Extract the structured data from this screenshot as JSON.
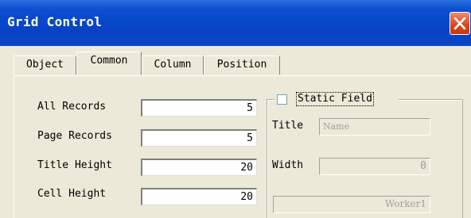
{
  "window": {
    "title": "Grid Control",
    "close_icon": "close-icon"
  },
  "tabs": [
    {
      "label": "Object"
    },
    {
      "label": "Common"
    },
    {
      "label": "Column"
    },
    {
      "label": "Position"
    }
  ],
  "active_tab": "Common",
  "fields": {
    "all_records": {
      "label": "All Records",
      "value": "5"
    },
    "page_records": {
      "label": "Page Records",
      "value": "5"
    },
    "title_height": {
      "label": "Title Height",
      "value": "20"
    },
    "cell_height": {
      "label": "Cell Height",
      "value": "20"
    }
  },
  "static_field": {
    "label": "Static Field",
    "checked": false,
    "title": {
      "label": "Title",
      "placeholder": "Name"
    },
    "width": {
      "label": "Width",
      "value": "0"
    },
    "worker": {
      "value": "Worker1"
    }
  },
  "colors": {
    "titlebar": "#0a4fd0",
    "close": "#d9451b",
    "dialog_bg": "#ece9d8"
  }
}
